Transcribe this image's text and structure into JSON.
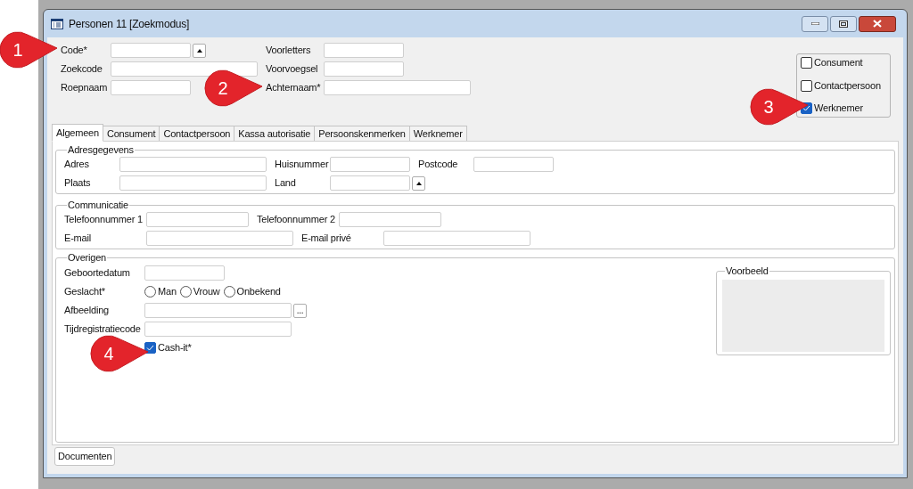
{
  "window": {
    "title": "Personen 11 [Zoekmodus]"
  },
  "header": {
    "left_fields": [
      {
        "label": "Code*",
        "kind": "lookup"
      },
      {
        "label": "Zoekcode",
        "kind": "wide"
      },
      {
        "label": "Roepnaam",
        "kind": "short"
      }
    ],
    "right_fields": [
      {
        "label": "Voorletters",
        "kind": "short"
      },
      {
        "label": "Voorvoegsel",
        "kind": "short"
      },
      {
        "label": "Achternaam*",
        "kind": "wide"
      }
    ],
    "roles": [
      {
        "label": "Consument",
        "checked": false
      },
      {
        "label": "Contactpersoon",
        "checked": false
      },
      {
        "label": "Werknemer",
        "checked": true
      }
    ]
  },
  "tabs": [
    {
      "label": "Algemeen",
      "selected": true
    },
    {
      "label": "Consument",
      "selected": false
    },
    {
      "label": "Contactpersoon",
      "selected": false
    },
    {
      "label": "Kassa autorisatie",
      "selected": false
    },
    {
      "label": "Persoonskenmerken",
      "selected": false
    },
    {
      "label": "Werknemer",
      "selected": false
    }
  ],
  "address": {
    "title": "Adresgegevens",
    "rows": [
      [
        {
          "label": "Adres",
          "kind": "wide"
        },
        {
          "label": "Huisnummer",
          "kind": "short"
        },
        {
          "label": "Postcode",
          "kind": "short"
        }
      ],
      [
        {
          "label": "Plaats",
          "kind": "wide"
        },
        {
          "label": "Land",
          "kind": "lookup"
        }
      ]
    ]
  },
  "communication": {
    "title": "Communicatie",
    "rows": [
      [
        {
          "label": "Telefoonnummer 1",
          "kind": "medium"
        },
        {
          "label": "Telefoonnummer 2",
          "kind": "medium"
        }
      ],
      [
        {
          "label": "E-mail",
          "kind": "wide"
        },
        {
          "label": "E-mail privé",
          "kind": "wide"
        }
      ]
    ]
  },
  "other": {
    "title": "Overigen",
    "rows": [
      {
        "kind": "short",
        "label": "Geboortedatum"
      },
      {
        "kind": "radios",
        "label": "Geslacht*",
        "options": [
          {
            "label": "Man",
            "selected": false
          },
          {
            "label": "Vrouw",
            "selected": false
          },
          {
            "label": "Onbekend",
            "selected": false
          }
        ]
      },
      {
        "kind": "browse",
        "label": "Afbeelding",
        "button": "..."
      },
      {
        "kind": "wide",
        "label": "Tijdregistratiecode"
      },
      {
        "kind": "checkbox",
        "label": "Cash-it*",
        "checked": true
      }
    ],
    "preview": {
      "title": "Voorbeeld"
    }
  },
  "footer": {
    "button": "Documenten"
  },
  "callouts": [
    {
      "number": "1"
    },
    {
      "number": "2"
    },
    {
      "number": "3"
    },
    {
      "number": "4"
    }
  ]
}
